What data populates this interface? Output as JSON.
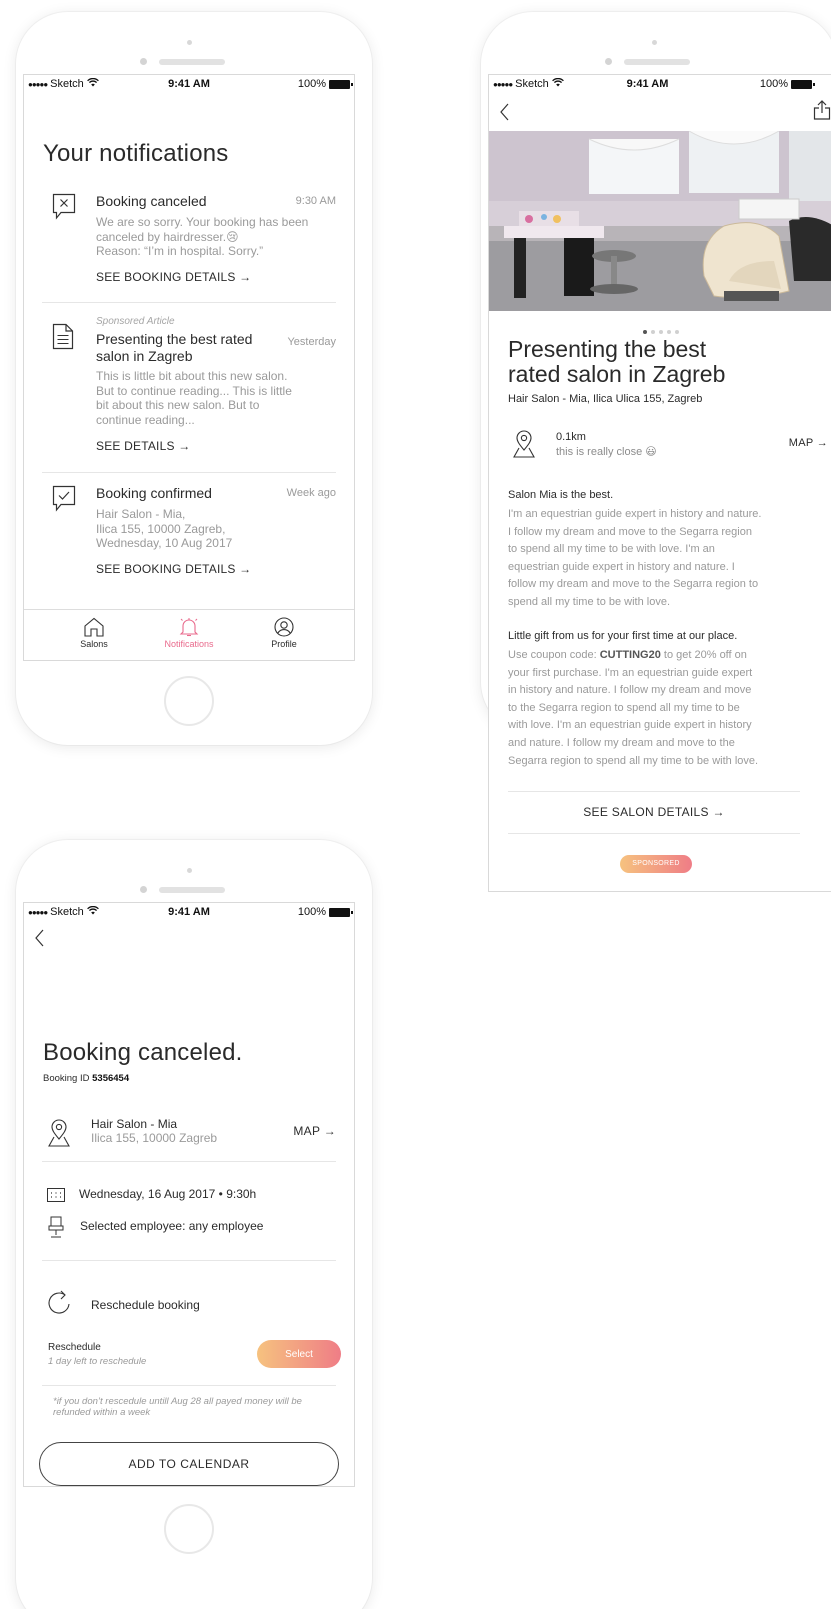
{
  "status_bar": {
    "carrier": "Sketch",
    "time": "9:41 AM",
    "battery": "100%"
  },
  "notifications_screen": {
    "title": "Your notifications",
    "items": [
      {
        "icon": "booking-canceled-icon",
        "title": "Booking canceled",
        "time": "9:30 AM",
        "body_lines": [
          "We are so sorry. Your booking has been",
          "canceled by hairdresser.😢",
          "Reason: “I’m in hospital. Sorry.”"
        ],
        "link": "SEE BOOKING DETAILS →"
      },
      {
        "icon": "article-icon",
        "tag": "Sponsored Article",
        "title_lines": [
          "Presenting the best rated",
          "salon in Zagreb"
        ],
        "time": "Yesterday",
        "body_lines": [
          "This is little bit about this new salon.",
          "But to continue reading... This is little",
          "bit about this new salon. But to",
          "continue reading..."
        ],
        "link": "SEE DETAILS →"
      },
      {
        "icon": "booking-confirmed-icon",
        "title": "Booking confirmed",
        "time": "Week ago",
        "body_lines": [
          "Hair Salon - Mia,",
          "Ilica 155, 10000 Zagreb,",
          "Wednesday, 10 Aug 2017"
        ],
        "link": "SEE BOOKING DETAILS →"
      }
    ],
    "tabs": [
      {
        "label": "Salons",
        "icon": "home-icon",
        "active": false
      },
      {
        "label": "Notifications",
        "icon": "bell-icon",
        "active": true
      },
      {
        "label": "Profile",
        "icon": "profile-icon",
        "active": false
      }
    ]
  },
  "article_screen": {
    "title_lines": [
      "Presenting the best",
      "rated salon in Zagreb"
    ],
    "subtitle": "Hair Salon - Mia, Ilica Ulica 155, Zagreb",
    "distance": "0.1km",
    "distance_note": "this is really close 😃",
    "map_link": "MAP →",
    "section1_heading": "Salon Mia is the best.",
    "section1_lines": [
      "I'm an equestrian guide expert in history and nature.",
      "I follow my dream and move to the Segarra region",
      "to spend all my time to be with love. I'm an",
      "equestrian guide expert in history and nature. I",
      "follow my dream and move to the Segarra region to",
      "spend all my time to be with love."
    ],
    "section2_heading": "Little gift from us for your first time at our place.",
    "section2_line1_prefix": "Use coupon code: ",
    "coupon_code": "CUTTING20",
    "section2_line1_suffix": " to get 20% off on",
    "section2_lines": [
      "your first purchase. I'm an equestrian guide expert",
      "in history and nature. I follow my dream and move",
      "to the Segarra region to spend all my time to be",
      "with love. I'm an equestrian guide expert in history",
      "and nature. I follow my dream and move to the",
      "Segarra region to spend all my time to be with love."
    ],
    "cta": "SEE SALON DETAILS →",
    "badge": "SPONSORED",
    "pager_total": 5,
    "pager_active": 0
  },
  "booking_screen": {
    "title": "Booking canceled.",
    "booking_id_label": "Booking ID ",
    "booking_id": "5356454",
    "salon_name": "Hair Salon - Mia",
    "salon_address": "Ilica 155, 10000 Zagreb",
    "map_link": "MAP →",
    "datetime": "Wednesday, 16 Aug 2017 • 9:30h",
    "employee": "Selected employee: any employee",
    "reschedule_title": "Reschedule booking",
    "reschedule_label": "Reschedule",
    "reschedule_sub": "1 day left to reschedule",
    "select_button": "Select",
    "note": "*if you don’t rescedule untill Aug 28 all payed money will be refunded within a week",
    "calendar_button": "ADD TO CALENDAR"
  },
  "colors": {
    "accent_pink": "#e96a8c",
    "gradient_start": "#f6c27f",
    "gradient_end": "#ef7d86"
  }
}
